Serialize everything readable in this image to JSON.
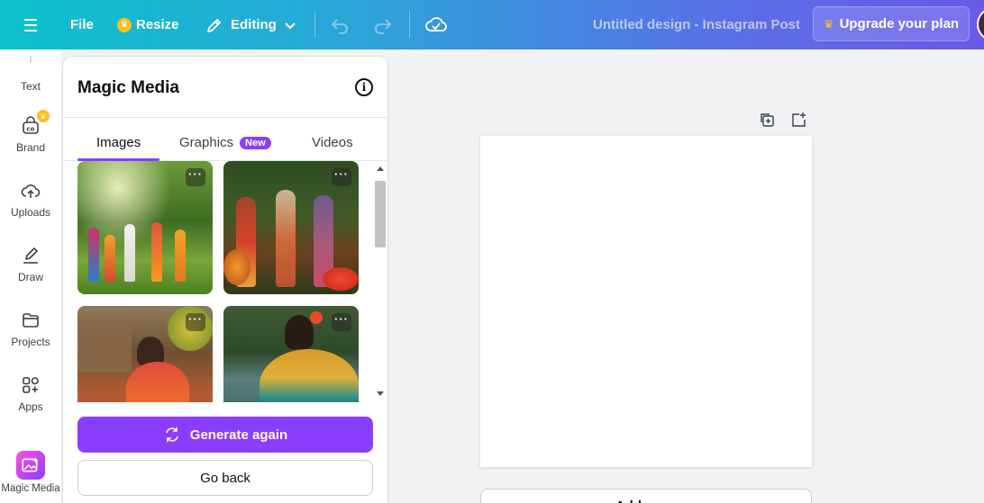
{
  "topbar": {
    "file_label": "File",
    "resize_label": "Resize",
    "editing_label": "Editing",
    "document_title": "Untitled design - Instagram Post",
    "upgrade_label": "Upgrade your plan",
    "crown_icon": "crown-icon",
    "gradient_colors": [
      "#0dc2cc",
      "#6a5ae8"
    ]
  },
  "rail": {
    "items": [
      {
        "label": "Text",
        "icon": "text-icon"
      },
      {
        "label": "Brand",
        "icon": "brand-icon"
      },
      {
        "label": "Uploads",
        "icon": "cloud-upload-icon"
      },
      {
        "label": "Draw",
        "icon": "pen-icon"
      },
      {
        "label": "Projects",
        "icon": "folder-icon"
      },
      {
        "label": "Apps",
        "icon": "apps-grid-icon"
      },
      {
        "label": "Magic Media",
        "icon": "magic-media-icon"
      }
    ]
  },
  "panel": {
    "title": "Magic Media",
    "tabs": [
      {
        "label": "Images",
        "active": true
      },
      {
        "label": "Graphics",
        "badge": "New"
      },
      {
        "label": "Videos"
      }
    ],
    "more_label": "···",
    "generate_label": "Generate again",
    "goback_label": "Go back",
    "accent_color": "#8b3dff"
  },
  "canvas": {
    "add_page_label": "Add page"
  }
}
